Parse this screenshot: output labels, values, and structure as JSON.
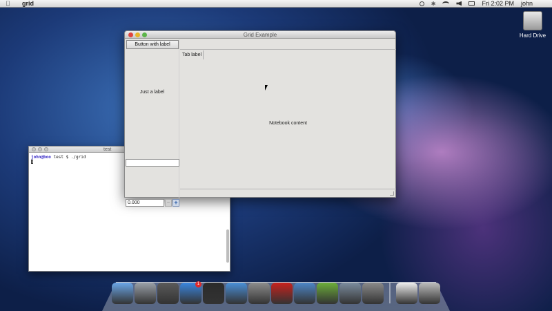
{
  "menubar": {
    "app_name": "grid",
    "clock": "Fri 2:02 PM",
    "user": "john"
  },
  "desktop": {
    "hard_drive_label": "Hard Drive"
  },
  "grid_window": {
    "title": "Grid Example",
    "button_label": "Button with label",
    "static_label": "Just a label",
    "entry_value": "",
    "spin_value": "0.000",
    "spin_minus": "−",
    "spin_plus": "+",
    "tab_label": "Tab label",
    "notebook_content": "Notebook content"
  },
  "terminal": {
    "title": "test",
    "prompt_user": "john@boo",
    "prompt_rest": " test $ ./grid"
  },
  "dock": {
    "items": [
      {
        "name": "finder-icon",
        "color": "#6aa6e8"
      },
      {
        "name": "launchpad-icon",
        "color": "#9aa0a8"
      },
      {
        "name": "mission-control-icon",
        "color": "#5a5a5a"
      },
      {
        "name": "app-store-icon",
        "color": "#3a86e0",
        "badge": "1"
      },
      {
        "name": "terminal-icon",
        "color": "#2b2b2b"
      },
      {
        "name": "safari-icon",
        "color": "#4a8fd8"
      },
      {
        "name": "system-preferences-icon",
        "color": "#8c8c8c"
      },
      {
        "name": "acrobat-icon",
        "color": "#c8221d"
      },
      {
        "name": "xcode-icon",
        "color": "#4d86c7"
      },
      {
        "name": "quicktime-icon",
        "color": "#6cae3a"
      },
      {
        "name": "iphoto-icon",
        "color": "#7b8c9e"
      },
      {
        "name": "display-icon",
        "color": "#8a8a8a"
      }
    ],
    "right_items": [
      {
        "name": "document-icon",
        "color": "#eeeeee"
      },
      {
        "name": "trash-icon",
        "color": "#bcbcbc"
      }
    ]
  }
}
